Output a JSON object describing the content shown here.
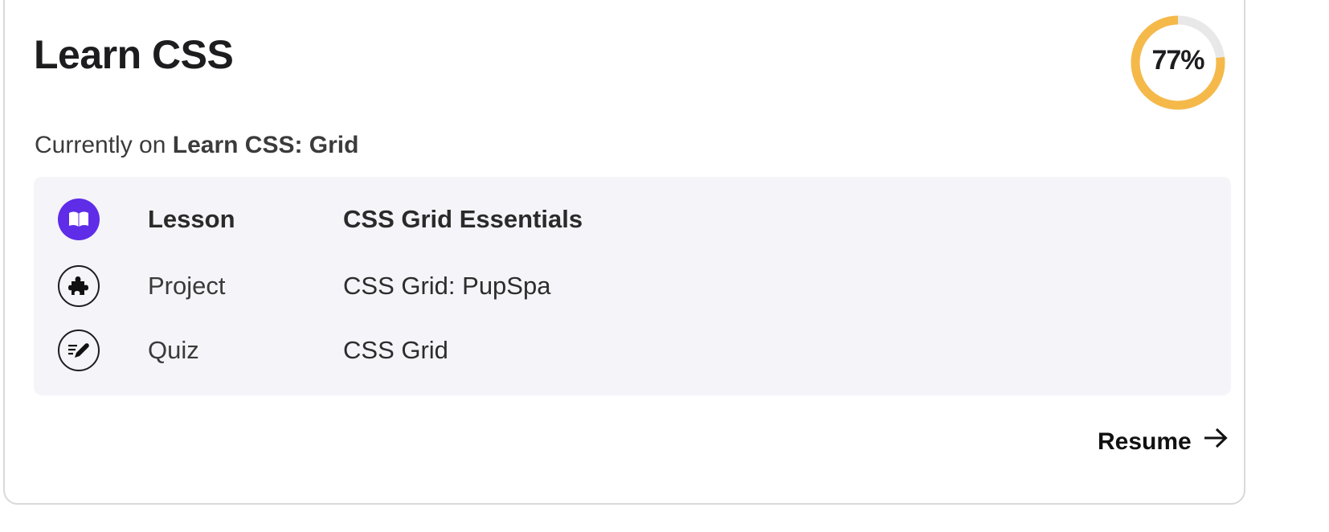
{
  "course": {
    "title": "Learn CSS",
    "progress_label": "77%",
    "progress_fraction": 0.77,
    "current_prefix": "Currently on",
    "current_module": "Learn CSS: Grid"
  },
  "items": [
    {
      "kind": "Lesson",
      "name": "CSS Grid Essentials",
      "icon": "book-icon",
      "active": true
    },
    {
      "kind": "Project",
      "name": "CSS Grid: PupSpa",
      "icon": "puzzle-icon",
      "active": false
    },
    {
      "kind": "Quiz",
      "name": "CSS Grid",
      "icon": "quiz-pencil-icon",
      "active": false
    }
  ],
  "actions": {
    "resume_label": "Resume"
  },
  "colors": {
    "accent": "#5f2ce8",
    "progress": "#f5b94a",
    "track": "#e8e8e8",
    "panel": "#f4f4f9"
  }
}
